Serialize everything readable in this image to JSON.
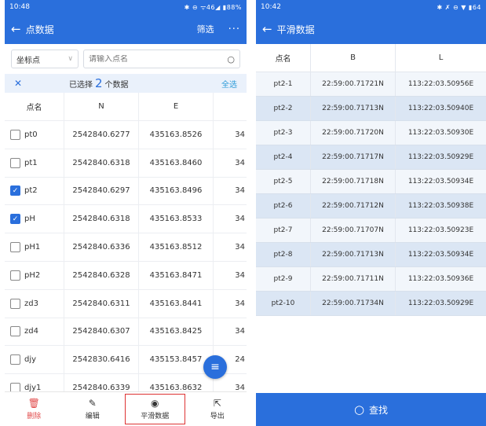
{
  "left": {
    "status": {
      "time": "10:48",
      "right": "✱ ⊖ ᯤ46◢ ▮88%"
    },
    "title": "点数据",
    "filter": "筛选",
    "more": "···",
    "select_value": "坐标点",
    "search_placeholder": "请输入点名",
    "selection": {
      "prefix": "已选择",
      "count": "2",
      "suffix": "个数据",
      "select_all": "全选"
    },
    "columns": [
      "点名",
      "N",
      "E"
    ],
    "rows": [
      {
        "name": "pt0",
        "n": "2542840.6277",
        "e": "435163.8526",
        "x": "34",
        "checked": false
      },
      {
        "name": "pt1",
        "n": "2542840.6318",
        "e": "435163.8460",
        "x": "34",
        "checked": false
      },
      {
        "name": "pt2",
        "n": "2542840.6297",
        "e": "435163.8496",
        "x": "34",
        "checked": true
      },
      {
        "name": "pH",
        "n": "2542840.6318",
        "e": "435163.8533",
        "x": "34",
        "checked": true
      },
      {
        "name": "pH1",
        "n": "2542840.6336",
        "e": "435163.8512",
        "x": "34",
        "checked": false
      },
      {
        "name": "pH2",
        "n": "2542840.6328",
        "e": "435163.8471",
        "x": "34",
        "checked": false
      },
      {
        "name": "zd3",
        "n": "2542840.6311",
        "e": "435163.8441",
        "x": "34",
        "checked": false
      },
      {
        "name": "zd4",
        "n": "2542840.6307",
        "e": "435163.8425",
        "x": "34",
        "checked": false
      },
      {
        "name": "djy",
        "n": "2542830.6416",
        "e": "435153.8457",
        "x": "24",
        "checked": false
      },
      {
        "name": "djy1",
        "n": "2542840.6339",
        "e": "435163.8632",
        "x": "34",
        "checked": false
      }
    ],
    "bottom": [
      {
        "icon": "trash-icon",
        "label": "删除"
      },
      {
        "icon": "edit-icon",
        "label": "编辑"
      },
      {
        "icon": "eye-icon",
        "label": "平滑数据"
      },
      {
        "icon": "export-icon",
        "label": "导出"
      }
    ]
  },
  "right": {
    "status": {
      "time": "10:42",
      "right": "✱ ✗ ⊖ ▼ ▮64"
    },
    "title": "平滑数据",
    "columns": [
      "点名",
      "B",
      "L"
    ],
    "rows": [
      {
        "name": "pt2-1",
        "b": "22:59:00.71721N",
        "l": "113:22:03.50956E"
      },
      {
        "name": "pt2-2",
        "b": "22:59:00.71713N",
        "l": "113:22:03.50940E"
      },
      {
        "name": "pt2-3",
        "b": "22:59:00.71720N",
        "l": "113:22:03.50930E"
      },
      {
        "name": "pt2-4",
        "b": "22:59:00.71717N",
        "l": "113:22:03.50929E"
      },
      {
        "name": "pt2-5",
        "b": "22:59:00.71718N",
        "l": "113:22:03.50934E"
      },
      {
        "name": "pt2-6",
        "b": "22:59:00.71712N",
        "l": "113:22:03.50938E"
      },
      {
        "name": "pt2-7",
        "b": "22:59:00.71707N",
        "l": "113:22:03.50923E"
      },
      {
        "name": "pt2-8",
        "b": "22:59:00.71713N",
        "l": "113:22:03.50934E"
      },
      {
        "name": "pt2-9",
        "b": "22:59:00.71711N",
        "l": "113:22:03.50936E"
      },
      {
        "name": "pt2-10",
        "b": "22:59:00.71734N",
        "l": "113:22:03.50929E"
      }
    ],
    "find_label": "查找"
  },
  "colors": {
    "primary": "#2a6fdc",
    "delete": "#e14b4b",
    "highlight_border": "#d33"
  }
}
